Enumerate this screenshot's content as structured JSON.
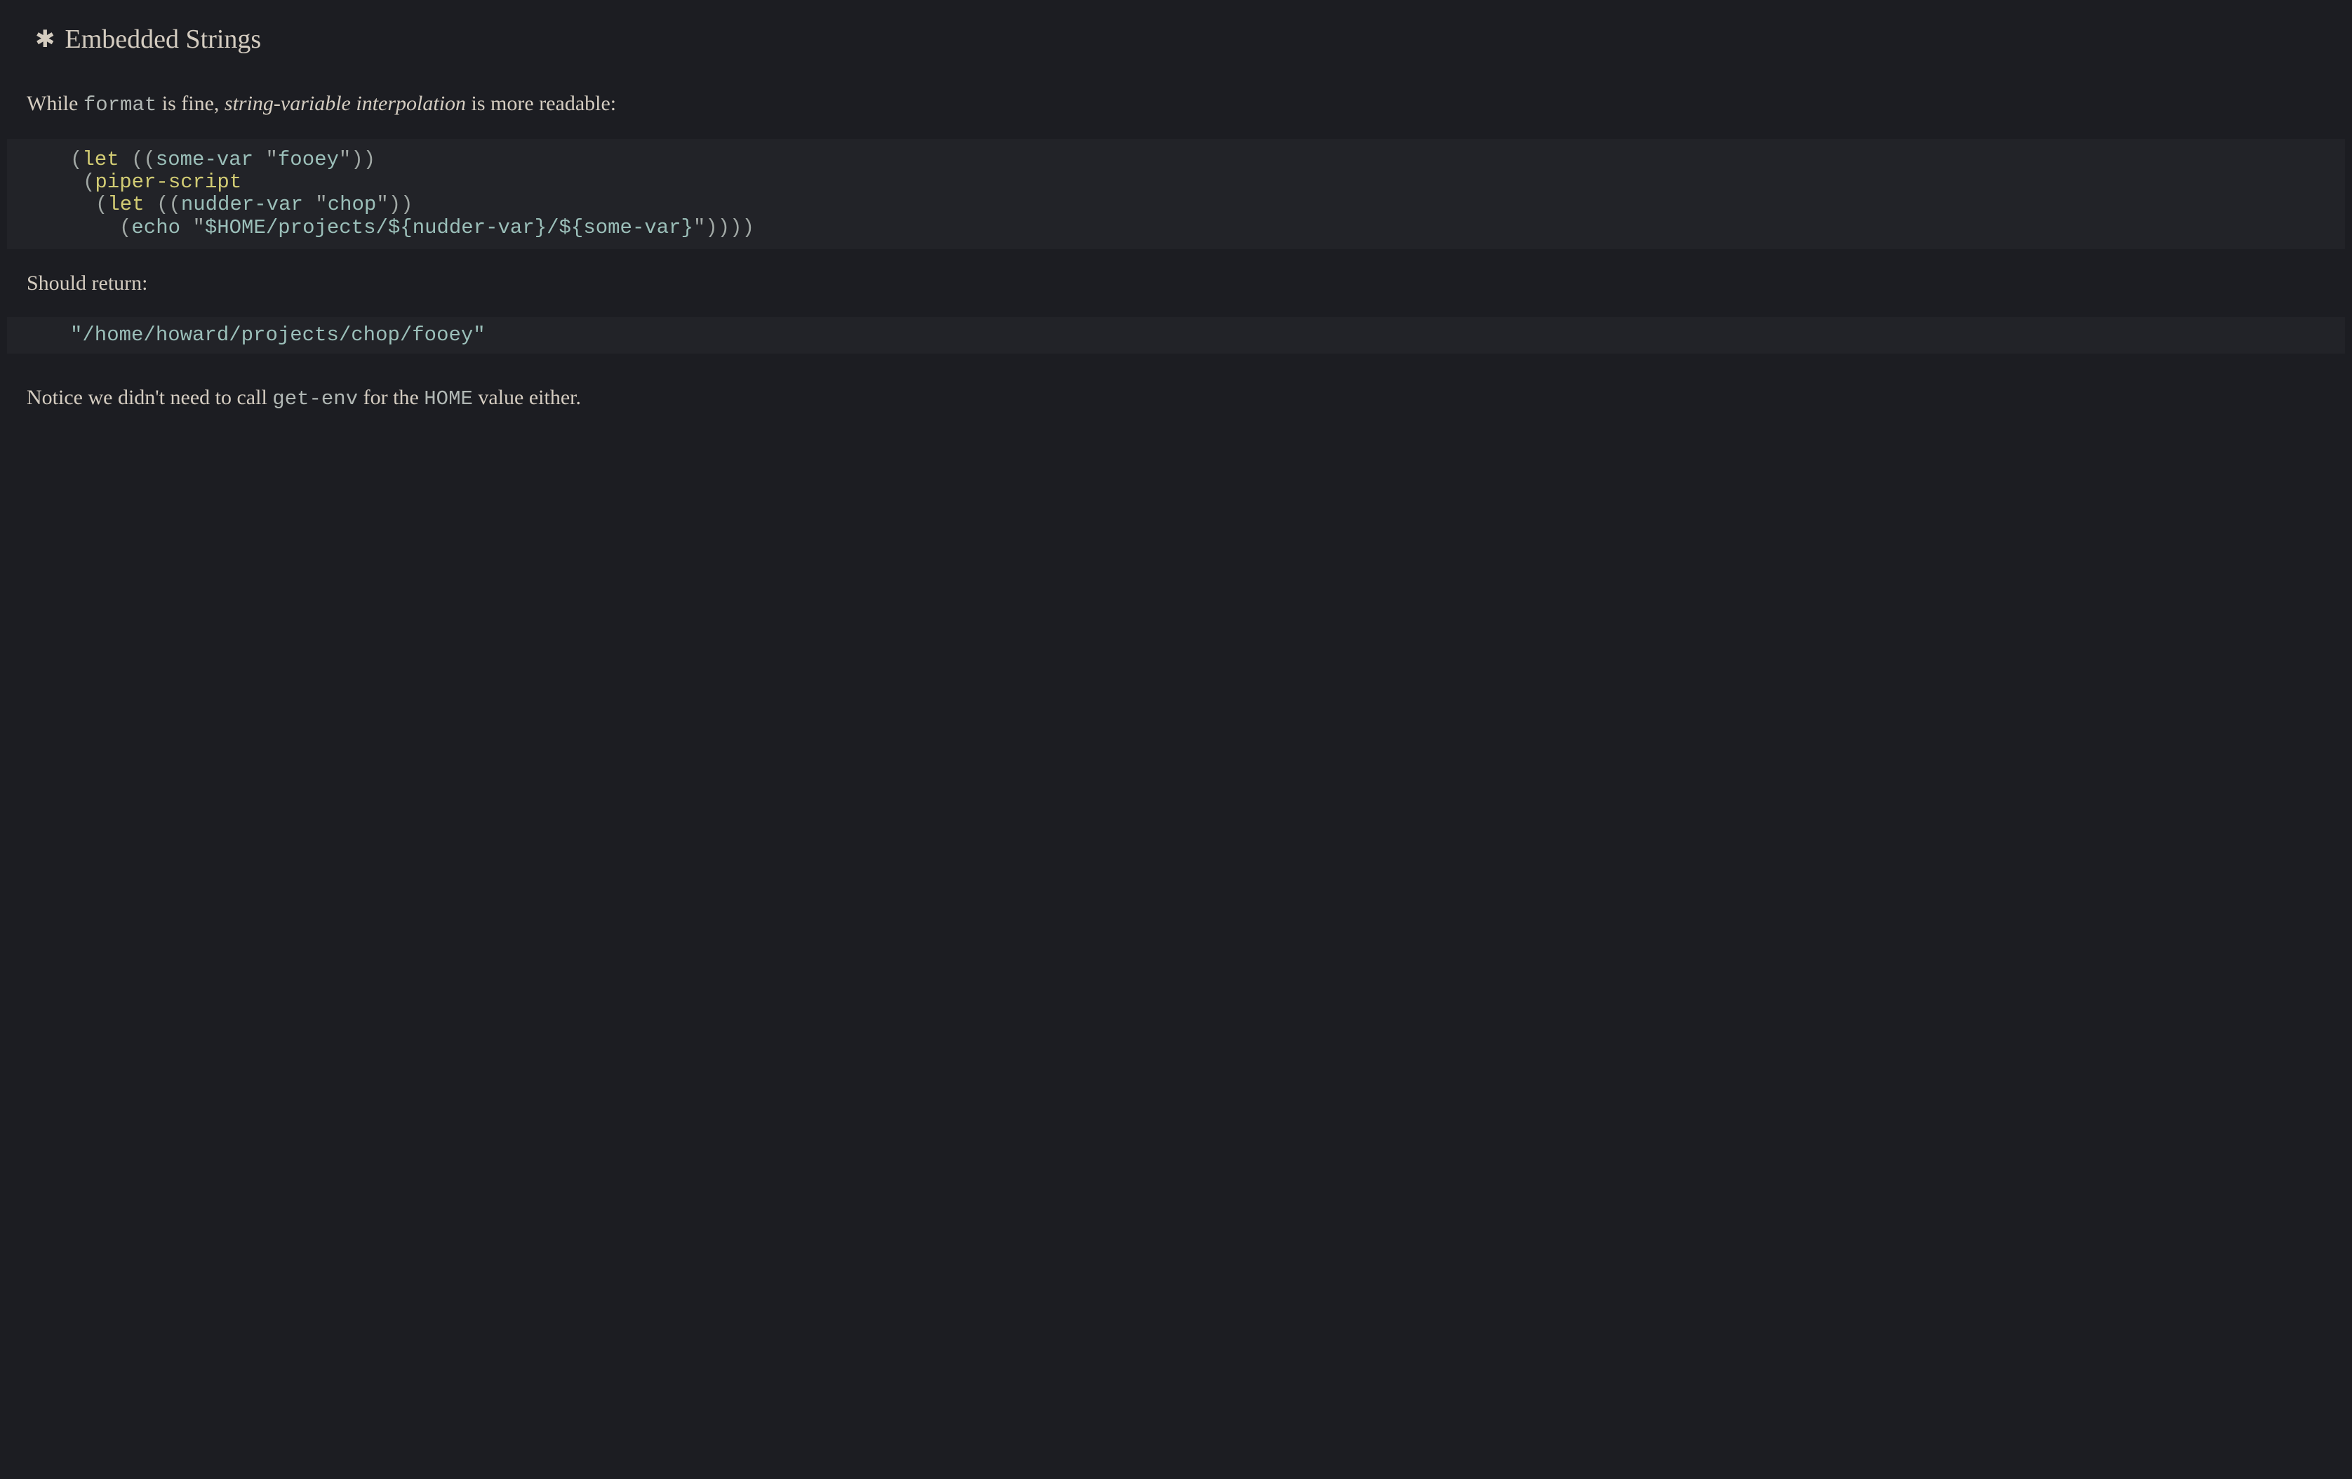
{
  "header": {
    "icon": "✱",
    "title": "Embedded Strings"
  },
  "intro": {
    "before": "While ",
    "code": "format",
    "mid": " is fine, ",
    "italic": "string-variable interpolation",
    "after": " is more readable:"
  },
  "code": {
    "line1": {
      "paren1": "(",
      "let": "let",
      "space1": " ",
      "paren2": "((",
      "var": "some-var",
      "space2": " ",
      "q1": "\"",
      "str": "fooey",
      "q2": "\"",
      "paren3": "))"
    },
    "line2": {
      "paren1": "(",
      "fn": "piper-script"
    },
    "line3": {
      "paren1": "(",
      "let": "let",
      "space1": " ",
      "paren2": "((",
      "var": "nudder-var",
      "space2": " ",
      "q1": "\"",
      "str": "chop",
      "q2": "\"",
      "paren3": "))"
    },
    "line4": {
      "paren1": "(",
      "fn": "echo",
      "space1": " ",
      "q1": "\"",
      "str": "$HOME/projects/${nudder-var}/${some-var}",
      "q2": "\"",
      "paren2": "))))"
    }
  },
  "return_label": "Should return:",
  "output": "\"/home/howard/projects/chop/fooey\"",
  "notice": {
    "before": "Notice we didn't need to call ",
    "code1": "get-env",
    "mid": " for the ",
    "code2": "HOME",
    "after": " value either."
  }
}
